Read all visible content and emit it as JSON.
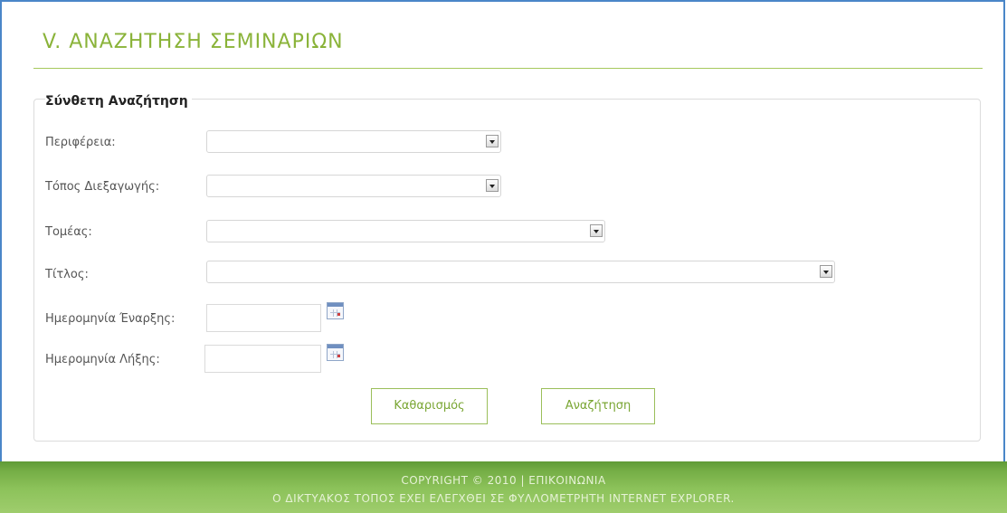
{
  "page": {
    "title": "V. ΑΝΑΖΗΤΗΣΗ ΣΕΜΙΝΑΡΙΩΝ"
  },
  "form": {
    "heading": "Σύνθετη Αναζήτηση",
    "fields": {
      "region": {
        "label": "Περιφέρεια:",
        "value": ""
      },
      "venue": {
        "label": "Τόπος Διεξαγωγής:",
        "value": ""
      },
      "sector": {
        "label": "Τομέας:",
        "value": ""
      },
      "title": {
        "label": "Τίτλος:",
        "value": ""
      },
      "start_date": {
        "label": "Ημερομηνία Έναρξης:",
        "value": ""
      },
      "end_date": {
        "label": "Ημερομηνία Λήξης:",
        "value": ""
      }
    },
    "buttons": {
      "clear": "Καθαρισμός",
      "search": "Αναζήτηση"
    }
  },
  "footer": {
    "line1": "COPYRIGHT © 2010 | ΕΠΙΚΟΙΝΩΝΙΑ",
    "line2": "Ο ΔΙΚΤΥΑΚΟΣ ΤΟΠΟΣ ΕΧΕΙ ΕΛΕΓΧΘΕΙ ΣΕ ΦΥΛΛΟΜΕΤΡΗΤΗ INTERNET EXPLORER."
  },
  "colors": {
    "accent": "#8ab339",
    "frame": "#4a86c8",
    "footer": "#74ad45"
  },
  "icons": {
    "dropdown": "chevron-down-icon",
    "calendar": "calendar-icon"
  }
}
